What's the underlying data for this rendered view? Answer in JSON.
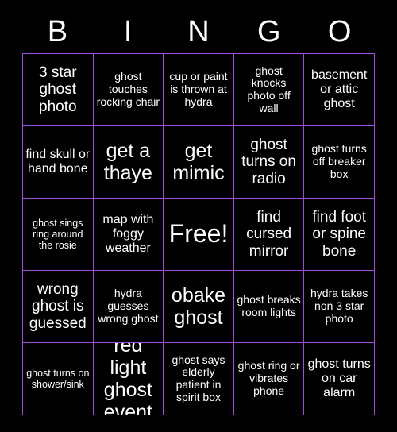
{
  "board": {
    "title": "BINGO",
    "border_color": "#9d4edd",
    "background_color": "#000000",
    "text_color": "#ffffff",
    "header_letters": [
      "B",
      "I",
      "N",
      "G",
      "O"
    ],
    "columns": 5,
    "rows": 5,
    "cells": [
      [
        {
          "text": "3 star ghost photo",
          "size": "lg",
          "free": false
        },
        {
          "text": "ghost touches rocking chair",
          "size": "sm",
          "free": false
        },
        {
          "text": "cup or paint is thrown at hydra",
          "size": "sm",
          "free": false
        },
        {
          "text": "ghost knocks photo off wall",
          "size": "sm",
          "free": false
        },
        {
          "text": "basement or attic ghost",
          "size": "md",
          "free": false
        }
      ],
      [
        {
          "text": "find skull or hand bone",
          "size": "md",
          "free": false
        },
        {
          "text": "get a thaye",
          "size": "xl",
          "free": false
        },
        {
          "text": "get mimic",
          "size": "xl",
          "free": false
        },
        {
          "text": "ghost turns on radio",
          "size": "lg",
          "free": false
        },
        {
          "text": "ghost turns off breaker box",
          "size": "sm",
          "free": false
        }
      ],
      [
        {
          "text": "ghost sings ring around the rosie",
          "size": "xs",
          "free": false
        },
        {
          "text": "map with foggy weather",
          "size": "md",
          "free": false
        },
        {
          "text": "Free!",
          "size": "xxl",
          "free": true
        },
        {
          "text": "find cursed mirror",
          "size": "lg",
          "free": false
        },
        {
          "text": "find foot or spine bone",
          "size": "lg",
          "free": false
        }
      ],
      [
        {
          "text": "wrong ghost is guessed",
          "size": "lg",
          "free": false
        },
        {
          "text": "hydra guesses wrong ghost",
          "size": "sm",
          "free": false
        },
        {
          "text": "obake ghost",
          "size": "xl",
          "free": false
        },
        {
          "text": "ghost breaks room lights",
          "size": "sm",
          "free": false
        },
        {
          "text": "hydra takes non 3 star photo",
          "size": "sm",
          "free": false
        }
      ],
      [
        {
          "text": "ghost turns on shower/sink",
          "size": "xs",
          "free": false
        },
        {
          "text": "red light ghost event",
          "size": "xl",
          "free": false
        },
        {
          "text": "ghost says elderly patient in spirit box",
          "size": "sm",
          "free": false
        },
        {
          "text": "ghost ring or vibrates phone",
          "size": "sm",
          "free": false
        },
        {
          "text": "ghost turns on car alarm",
          "size": "md",
          "free": false
        }
      ]
    ]
  }
}
